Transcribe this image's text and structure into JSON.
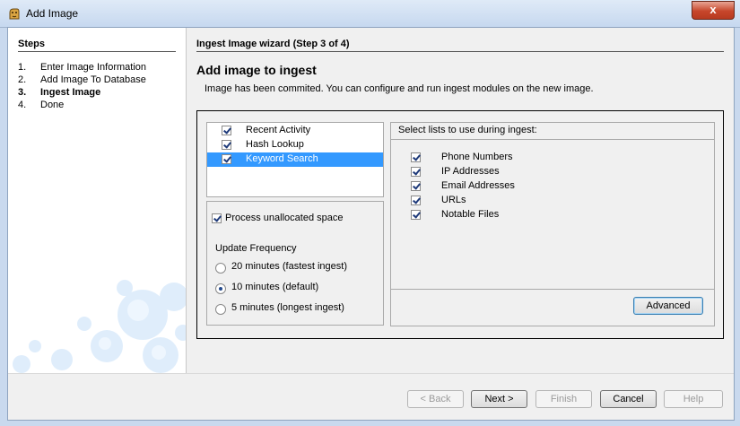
{
  "window": {
    "title": "Add Image",
    "close_label": "x",
    "app_icon": "autopsy-dog-icon",
    "close_color": "#c7462b"
  },
  "steps": {
    "title": "Steps",
    "items": [
      {
        "num": "1.",
        "label": "Enter Image Information"
      },
      {
        "num": "2.",
        "label": "Add Image To Database"
      },
      {
        "num": "3.",
        "label": "Ingest Image",
        "current": true
      },
      {
        "num": "4.",
        "label": "Done"
      }
    ]
  },
  "wizard": {
    "title": "Ingest Image wizard (Step 3 of 4)",
    "page_title": "Add image to ingest",
    "page_subtitle": "Image has been commited.  You can configure and run ingest modules on the new image."
  },
  "modules": [
    {
      "label": "Recent Activity",
      "checked": true
    },
    {
      "label": "Hash Lookup",
      "checked": true
    },
    {
      "label": "Keyword Search",
      "checked": true,
      "selected": true
    }
  ],
  "options": {
    "process_unallocated_label": "Process unallocated space",
    "process_unallocated_checked": true,
    "update_frequency_label": "Update Frequency",
    "frequencies": [
      {
        "label": "20 minutes (fastest ingest)",
        "selected": false
      },
      {
        "label": "10 minutes (default)",
        "selected": true
      },
      {
        "label": "5 minutes (longest ingest)",
        "selected": false
      }
    ]
  },
  "lists": {
    "header": "Select lists to use during ingest:",
    "items": [
      {
        "label": "Phone Numbers",
        "checked": true
      },
      {
        "label": "IP Addresses",
        "checked": true
      },
      {
        "label": "Email Addresses",
        "checked": true
      },
      {
        "label": "URLs",
        "checked": true
      },
      {
        "label": "Notable Files",
        "checked": true
      }
    ],
    "advanced_label": "Advanced"
  },
  "footer": {
    "back_label": "< Back",
    "next_label": "Next >",
    "finish_label": "Finish",
    "cancel_label": "Cancel",
    "help_label": "Help"
  },
  "colors": {
    "selection": "#3399ff",
    "titlebar": "#c6d8ef"
  }
}
